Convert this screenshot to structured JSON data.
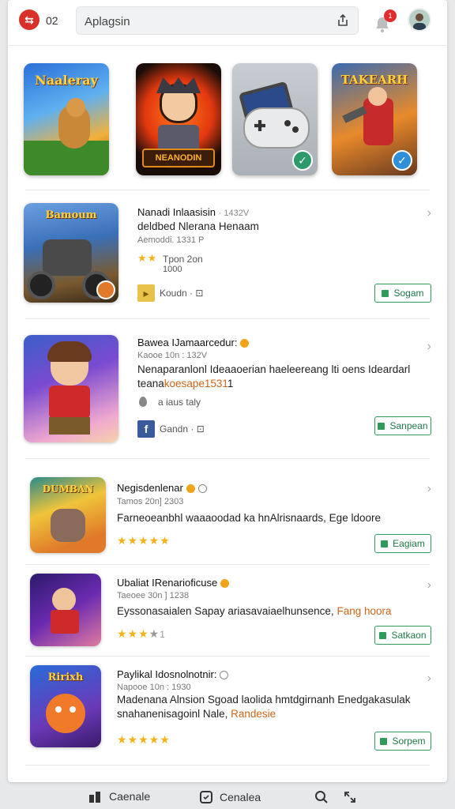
{
  "header": {
    "badge_count": "02",
    "search_text": "Aplagsin",
    "notification_count": "1"
  },
  "featured": [
    {
      "title": "Naaleray"
    },
    {
      "title": "NEANODIN"
    },
    {
      "title": ""
    },
    {
      "title": "TAKEARH"
    }
  ],
  "apps": [
    {
      "thumb_title": "Bamoum",
      "name": "Nanadi Inlaasisin",
      "name_extra": "· 1432V",
      "sub": "",
      "desc_line1": "deldbed Nlerana Henaam",
      "desc_line2": "",
      "code": "Aemoddi. 1331 P",
      "rating_label": "Tpon  2on",
      "rating_label2": "1000",
      "meta_label": "Koudn · ⊡",
      "button_label": "Sogam"
    },
    {
      "thumb_title": "",
      "name": "Bawea IJamaarcedur:",
      "sub": "Kaooe 10n : 132V",
      "desc_line1": "Nenaparanlonl Ideaaoerian haeleereang lti oens Ideardarl",
      "desc_line2": "teanakoesape1531",
      "desc_line2_plain": "teana",
      "desc_line2_accent": "koesape1531",
      "desc_line2_tail": "1",
      "meta_label": "a iaus taly",
      "meta2_label": "Gandn · ⊡",
      "button_label": "Sanpean"
    },
    {
      "thumb_title": "DUMBAN",
      "name": "Negisdenlenar",
      "sub": "Tamos 20n] 2303",
      "desc_line1": "Farneoeanbhl waaaoodad ka hnAlrisnaards, Ege ldoore",
      "stars": "★★★★★",
      "button_label": "Eagiam"
    },
    {
      "thumb_title": "",
      "name": "Ubaliat IRenarioficuse",
      "sub": "Taeoee 30n ] 1238",
      "desc_line1": "Eyssonasaialen Sapay ariasavaiaelhunsence,",
      "desc_line1_accent": "Fang hoora",
      "stars": "★★★",
      "stars_grey": "★",
      "stars_num": "1",
      "button_label": "Satkaon"
    },
    {
      "thumb_title": "Ririxh",
      "name": "Paylikal Idosnolnotnir:",
      "sub": "Napooe 10n : 1930",
      "desc_line1": "Madenana Alnsion Sgoad laolida hmtdgirnanh Enedgakasulak",
      "desc_line2": "snahanenisagoinl Nale,",
      "desc_line2_accent": "Randesie",
      "stars": "★★★★★",
      "button_label": "Sorpem"
    }
  ],
  "bottom_nav": {
    "item1": "Caenale",
    "item2": "Cenalea"
  },
  "colors": {
    "accent_orange": "#d0661a",
    "button_green": "#2f9a5a",
    "brand_red": "#d9302a",
    "star": "#f3b21a"
  }
}
